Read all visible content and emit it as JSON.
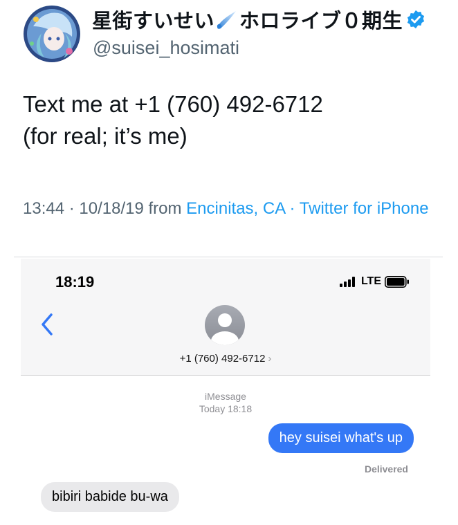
{
  "author": {
    "display_name_part1": "星街すいせい",
    "display_name_part2": "ホロライブ０期生",
    "handle": "@suisei_hosimati",
    "icons": [
      "avatar-image",
      "comet-icon",
      "verified-icon"
    ]
  },
  "tweet": {
    "line1": "Text me at +1 (760) 492-6712",
    "line2": "(for real; it’s me)",
    "time_date": "13:44 · 10/18/19 from ",
    "location": "Encinitas, CA",
    "sep": " · ",
    "source": "Twitter for iPhone"
  },
  "phone": {
    "status_time": "18:19",
    "network": "LTE",
    "contact_number": "+1 (760) 492-6712",
    "chevron": "›",
    "service_label": "iMessage",
    "service_time": "Today 18:18",
    "messages": [
      {
        "direction": "sent",
        "text": "hey suisei what's up"
      },
      {
        "direction": "received",
        "text": "bibiri babide bu-wa"
      }
    ],
    "delivered_label": "Delivered"
  },
  "colors": {
    "link": "#1d9bf0",
    "sent_bubble": "#3478f6",
    "received_bubble": "#e9e9eb",
    "verified": "#1d9bf0"
  }
}
